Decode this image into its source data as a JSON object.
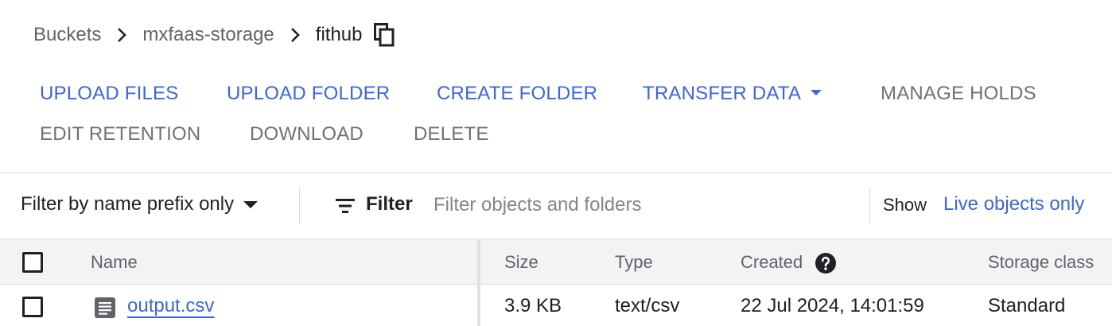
{
  "breadcrumb": {
    "items": [
      "Buckets",
      "mxfaas-storage"
    ],
    "current": "fithub"
  },
  "actions": {
    "upload_files": "UPLOAD FILES",
    "upload_folder": "UPLOAD FOLDER",
    "create_folder": "CREATE FOLDER",
    "transfer_data": "TRANSFER DATA",
    "manage_holds": "MANAGE HOLDS",
    "edit_retention": "EDIT RETENTION",
    "download": "DOWNLOAD",
    "delete": "DELETE"
  },
  "filterbar": {
    "prefix_select": "Filter by name prefix only",
    "filter_label": "Filter",
    "search_placeholder": "Filter objects and folders",
    "show_label": "Show",
    "show_value": "Live objects only"
  },
  "table": {
    "columns": {
      "name": "Name",
      "size": "Size",
      "type": "Type",
      "created": "Created",
      "storage_class": "Storage class"
    },
    "rows": [
      {
        "name": "output.csv",
        "size": "3.9 KB",
        "type": "text/csv",
        "created": "22 Jul 2024, 14:01:59",
        "storage_class": "Standard"
      }
    ]
  },
  "colors": {
    "accent": "#3c66d9",
    "disabled_text": "#6e7175",
    "header_bg": "#f1f3f4",
    "divider": "#dadce0"
  }
}
